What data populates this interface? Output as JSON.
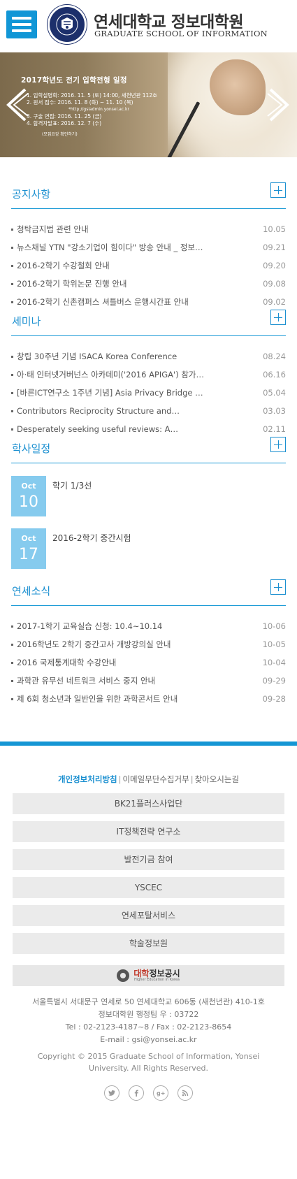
{
  "header": {
    "logo_ko": "연세대학교 정보대학원",
    "logo_en": "GRADUATE SCHOOL OF INFORMATION",
    "emblem_text": "YONSEI UNIVERSITY"
  },
  "hero": {
    "title": "2017학년도 전기 입학전형 일정",
    "lines": [
      "1. 입학설명회: 2016. 11. 5 (토) 14:00, 새천년관 112호",
      "2. 원서  접수: 2016. 11. 8 (화) ~ 11. 10 (목)",
      "*http://gsiadmin.yonsei.ac.kr",
      "3. 구술  면접: 2016. 11. 25 (금)",
      "4. 합격자발표: 2016. 12. 7 (수)",
      "(모집요강 확인하기)"
    ]
  },
  "sections": {
    "notice": {
      "title": "공지사항",
      "items": [
        {
          "title": "청탁금지법 관련 안내",
          "date": "10.05"
        },
        {
          "title": "뉴스채널 YTN \"강소기업이 힘이다\" 방송 안내 _ 정보…",
          "date": "09.21"
        },
        {
          "title": "2016-2학기 수강철회 안내",
          "date": "09.20"
        },
        {
          "title": "2016-2학기 학위논문 진행 안내",
          "date": "09.08"
        },
        {
          "title": "2016-2학기 신촌캠퍼스 셔틀버스 운행시간표 안내",
          "date": "09.02"
        }
      ]
    },
    "seminar": {
      "title": "세미나",
      "items": [
        {
          "title": "창립 30주년 기념 ISACA Korea Conference",
          "date": "08.24"
        },
        {
          "title": "아·태 인터넷거버넌스 아카데미('2016 APIGA') 참가…",
          "date": "06.16"
        },
        {
          "title": "[바른ICT연구소 1주년 기념] Asia Privacy Bridge …",
          "date": "05.04"
        },
        {
          "title": "Contributors Reciprocity Structure and…",
          "date": "03.03"
        },
        {
          "title": "Desperately seeking useful reviews: A…",
          "date": "02.11"
        }
      ]
    },
    "schedule": {
      "title": "학사일정",
      "items": [
        {
          "month": "Oct",
          "day": "10",
          "title": "학기 1/3선"
        },
        {
          "month": "Oct",
          "day": "17",
          "title": "2016-2학기 중간시험"
        }
      ]
    },
    "news": {
      "title": "연세소식",
      "items": [
        {
          "title": "2017-1학기 교육실습 신청: 10.4~10.14",
          "date": "10-06"
        },
        {
          "title": "2016학년도 2학기 중간고사 개방강의실 안내",
          "date": "10-05"
        },
        {
          "title": "2016 국제통계대학 수강안내",
          "date": "10-04"
        },
        {
          "title": "과학관 유무선 네트워크 서비스 중지 안내",
          "date": "09-29"
        },
        {
          "title": "제 6회 청소년과 일반인을 위한 과학콘서트 안내",
          "date": "09-28"
        }
      ]
    }
  },
  "footer": {
    "links": [
      "개인정보처리방침",
      "이메일무단수집거부",
      "찾아오시는길"
    ],
    "buttons": [
      "BK21플러스사업단",
      "IT정책전략 연구소",
      "발전기금 참여",
      "YSCEC",
      "연세포탈서비스",
      "학술정보원"
    ],
    "disclosure": {
      "ko_red": "대학",
      "ko_rest": "정보공시",
      "en": "Higher Education in Korea"
    },
    "address": [
      "서울특별시 서대문구 연세로 50 연세대학교 606동 (새천년관) 410-1호",
      "정보대학원 행정팀 우 : 03722",
      "Tel : 02-2123-4187~8 /   Fax : 02-2123-8654",
      "E-mail : gsi@yonsei.ac.kr"
    ],
    "copyright": "Copyright © 2015 Graduate School of Information, Yonsei University. All Rights Reserved.",
    "social": [
      "twitter-icon",
      "facebook-icon",
      "google-plus-icon",
      "rss-icon"
    ]
  },
  "colors": {
    "accent": "#1596d4",
    "calendar": "#86cbee",
    "button_bg": "#ebebeb"
  }
}
